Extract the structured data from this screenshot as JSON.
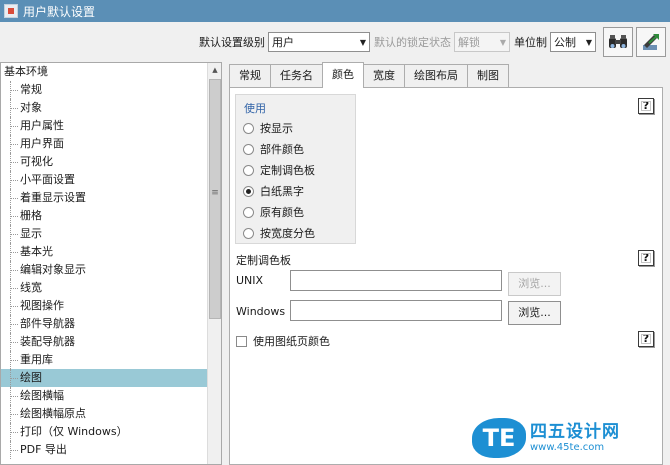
{
  "window": {
    "title": "用户默认设置"
  },
  "toolbar": {
    "level_label": "默认设置级别",
    "level_value": "用户",
    "lock_label": "默认的锁定状态",
    "lock_value": "解锁",
    "units_label": "单位制",
    "units_value": "公制",
    "icons": [
      "binoculars-icon",
      "export-icon"
    ]
  },
  "tree": {
    "root": "基本环境",
    "items": [
      "常规",
      "对象",
      "用户属性",
      "用户界面",
      "可视化",
      "小平面设置",
      "着重显示设置",
      "栅格",
      "显示",
      "基本光",
      "编辑对象显示",
      "线宽",
      "视图操作",
      "部件导航器",
      "装配导航器",
      "重用库",
      "绘图",
      "绘图横幅",
      "绘图横幅原点",
      "打印（仅 Windows）",
      "PDF 导出"
    ],
    "selected_index": 16
  },
  "tabs": [
    "常规",
    "任务名",
    "颜色",
    "宽度",
    "绘图布局",
    "制图"
  ],
  "active_tab_index": 2,
  "use_group": {
    "title": "使用",
    "options": [
      "按显示",
      "部件颜色",
      "定制调色板",
      "白纸黑字",
      "原有颜色",
      "按宽度分色"
    ],
    "selected_index": 3
  },
  "palette": {
    "title": "定制调色板",
    "unix_label": "UNIX",
    "unix_value": "",
    "windows_label": "Windows",
    "windows_value": "",
    "browse_label": "浏览..."
  },
  "use_page_color_label": "使用图纸页颜色",
  "help_glyph": "?",
  "watermark": {
    "logo": "TE",
    "name": "四五设计网",
    "url": "www.45te.com"
  }
}
